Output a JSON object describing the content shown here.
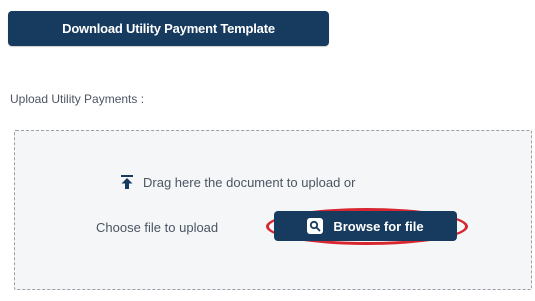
{
  "toolbar": {
    "download_label": "Download Utility Payment Template"
  },
  "upload": {
    "label": "Upload Utility Payments :",
    "drag_text": "Drag here the document to upload or",
    "choose_text": "Choose file to upload",
    "browse_label": "Browse for file",
    "icons": {
      "upload": "upload-arrow-icon",
      "search": "search-icon"
    },
    "highlight_color": "#d7262f",
    "button_color": "#173b5f"
  }
}
